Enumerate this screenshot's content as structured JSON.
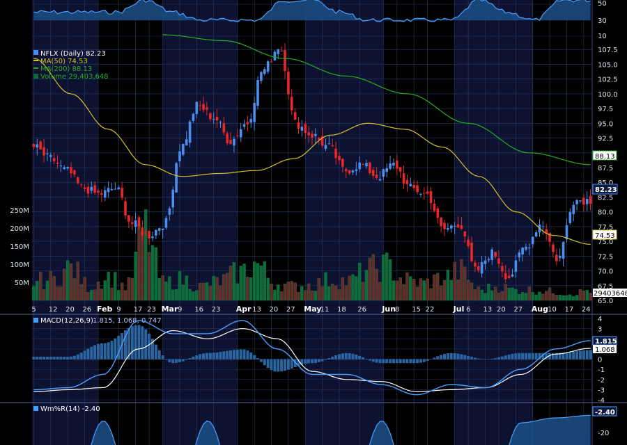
{
  "chart_data": {
    "type": "candlestick",
    "symbol": "NFLX",
    "legend": {
      "price": "NFLX (Daily) 82.23",
      "ma50": "MA(50) 74.53",
      "ma200": "MA(200) 88.13",
      "volume": "Volume 29,403,648",
      "macd_name": "MACD(12,26,9)",
      "macd_vals": "1.815, 1.068, 0.747",
      "willr": "Wm%R(14) -2.40"
    },
    "x_labels": [
      "5",
      "12",
      "20",
      "26",
      "Feb",
      "9",
      "17",
      "23",
      "Mar",
      "9",
      "16",
      "23",
      "Apr",
      "13",
      "20",
      "27",
      "May",
      "11",
      "18",
      "26",
      "Jun",
      "8",
      "15",
      "22",
      "Jul",
      "6",
      "13",
      "20",
      "27",
      "Aug",
      "10",
      "17",
      "24"
    ],
    "price_axis": {
      "ticks": [
        "107.5",
        "105.0",
        "102.5",
        "100.0",
        "97.5",
        "95.0",
        "92.5",
        "90.0",
        "87.5",
        "85.0",
        "82.5",
        "80.0",
        "77.5",
        "75.0",
        "72.5",
        "70.0",
        "67.5",
        "65.0"
      ],
      "ylim": [
        65.0,
        110.0
      ]
    },
    "volume_axis": {
      "ticks": [
        "250M",
        "200M",
        "150M",
        "100M",
        "50M"
      ]
    },
    "macd_axis": {
      "ticks": [
        "4",
        "3",
        "2",
        "1",
        "0",
        "-1",
        "-2",
        "-3",
        "-4"
      ]
    },
    "willr_axis": {
      "ticks": [
        "-20"
      ]
    },
    "top_panel_axis": {
      "ticks": [
        "50",
        "30",
        "10"
      ]
    },
    "value_tags": {
      "last": "82.23",
      "ma200": "88.13",
      "ma50": "74.53",
      "volume": "29403648",
      "macd": "1.815",
      "signal": "1.068",
      "willr": "-2.40"
    },
    "anchors": {
      "close": [
        91,
        89,
        87,
        84,
        83,
        84,
        78,
        76,
        78,
        91,
        98,
        96,
        92,
        95,
        104,
        108,
        95,
        93,
        91,
        87,
        88,
        86,
        88,
        84,
        83,
        77,
        78,
        70,
        73,
        69,
        74,
        78,
        72,
        82,
        82
      ],
      "ma50": [
        106,
        100,
        94,
        88,
        86,
        86.5,
        87,
        89,
        93,
        95,
        94,
        91,
        86,
        80,
        76,
        74.5
      ],
      "ma200": [
        110,
        109,
        106,
        103,
        100,
        95,
        90,
        88
      ],
      "volume_millions": [
        55,
        60,
        95,
        40,
        70,
        40,
        200,
        50,
        60,
        40,
        55,
        80,
        105,
        50,
        40,
        45,
        60,
        55,
        90,
        100,
        60,
        50,
        65,
        85,
        30,
        40,
        30,
        30,
        25,
        20,
        30
      ],
      "macd": [
        -3.0,
        -2.8,
        -1.5,
        3.8,
        2.5,
        2.5,
        3.8,
        1.0,
        -1.5,
        -1.5,
        -2.5,
        -3.5,
        -2.5,
        -2.8,
        -1.0,
        1.0,
        1.815
      ],
      "signal": [
        -3.2,
        -3.0,
        -2.8,
        1.0,
        2.8,
        2.0,
        3.0,
        2.0,
        -1.2,
        -2.0,
        -2.2,
        -3.2,
        -3.0,
        -2.8,
        -1.5,
        0.5,
        1.068
      ],
      "willr": [
        -100,
        -100,
        -8,
        -100,
        -100,
        -8,
        -100,
        -100,
        -100,
        -100,
        -8,
        -100,
        -60,
        -100,
        -10,
        -5,
        -2.4
      ]
    }
  },
  "colors": {
    "up": "#4a8ef0",
    "down": "#e82828",
    "ma50": "#d8c02a",
    "ma200": "#22b022",
    "volume": "#0f6a3c",
    "volume_down": "#6a2a2a",
    "macd": "#4aa0ff",
    "signal": "#ffffff",
    "histogram": "#2c6aa8",
    "grid": "#283a66",
    "panel_bg": "#06070f"
  }
}
